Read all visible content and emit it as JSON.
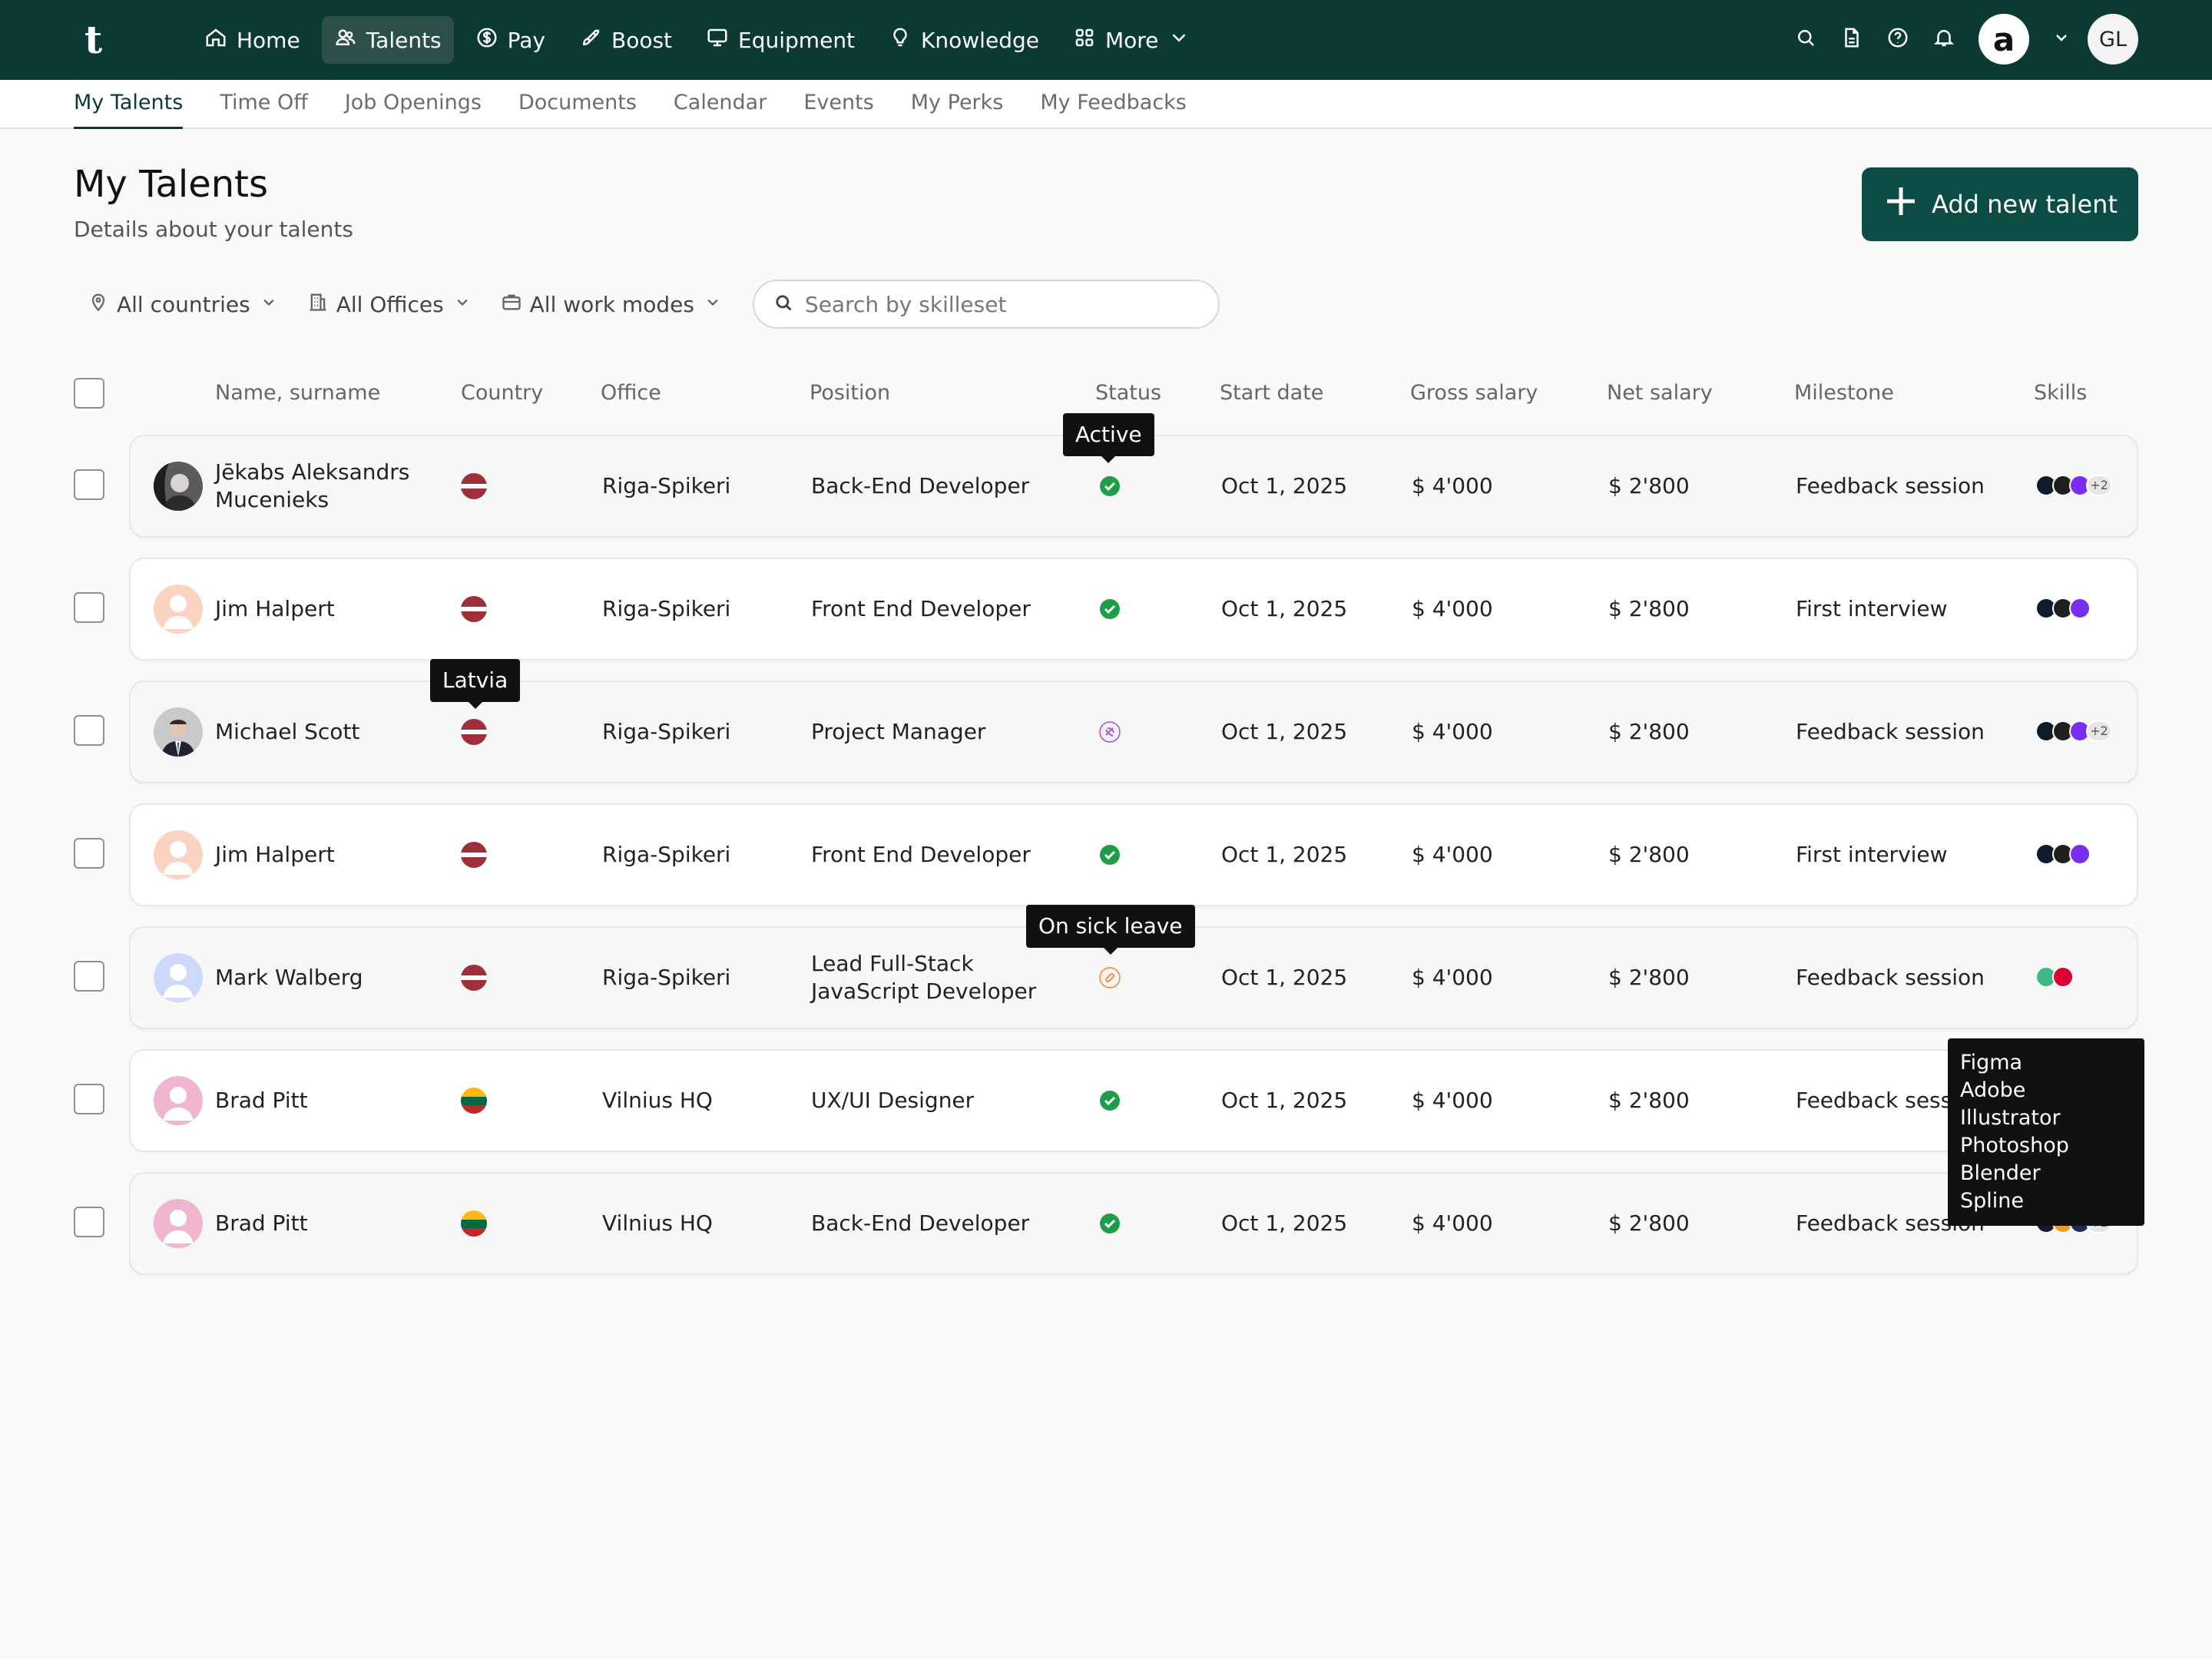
{
  "app": {
    "logo": "t"
  },
  "nav": [
    {
      "label": "Home",
      "icon": "home-icon"
    },
    {
      "label": "Talents",
      "icon": "users-icon",
      "active": true
    },
    {
      "label": "Pay",
      "icon": "dollar-icon"
    },
    {
      "label": "Boost",
      "icon": "rocket-icon"
    },
    {
      "label": "Equipment",
      "icon": "monitor-icon"
    },
    {
      "label": "Knowledge",
      "icon": "lightbulb-icon"
    },
    {
      "label": "More",
      "icon": "grid-icon"
    }
  ],
  "header_right": {
    "company_logo": "a",
    "user_initials": "GL"
  },
  "subnav": [
    "My Talents",
    "Time Off",
    "Job Openings",
    "Documents",
    "Calendar",
    "Events",
    "My Perks",
    "My Feedbacks"
  ],
  "page": {
    "title": "My Talents",
    "subtitle": "Details about your talents",
    "add_button": "Add new talent"
  },
  "filters": {
    "countries": "All countries",
    "offices": "All Offices",
    "work_modes": "All work modes",
    "search_placeholder": "Search by skilleset"
  },
  "columns": {
    "name": "Name, surname",
    "country": "Country",
    "office": "Office",
    "position": "Position",
    "status": "Status",
    "start_date": "Start date",
    "gross": "Gross salary",
    "net": "Net salary",
    "milestone": "Milestone",
    "skills": "Skills"
  },
  "rows": [
    {
      "name": "Jēkabs Aleksandrs Mucenieks",
      "country": "latvia",
      "office": "Riga-Spikeri",
      "position": "Back-End Developer",
      "status": "active",
      "start": "Oct 1, 2025",
      "gross": "$ 4'000",
      "net": "$ 2'800",
      "milestone": "Feedback session",
      "skills_more": "+2",
      "avatar": "photo-dark"
    },
    {
      "name": "Jim Halpert",
      "country": "latvia",
      "office": "Riga-Spikeri",
      "position": "Front End Developer",
      "status": "active",
      "start": "Oct 1, 2025",
      "gross": "$ 4'000",
      "net": "$ 2'800",
      "milestone": "First interview",
      "skills_more": "",
      "avatar": "placeholder-peach"
    },
    {
      "name": "Michael Scott",
      "country": "latvia",
      "office": "Riga-Spikeri",
      "position": "Project Manager",
      "status": "vacation",
      "start": "Oct 1, 2025",
      "gross": "$ 4'000",
      "net": "$ 2'800",
      "milestone": "Feedback session",
      "skills_more": "+2",
      "avatar": "photo-suit"
    },
    {
      "name": "Jim Halpert",
      "country": "latvia",
      "office": "Riga-Spikeri",
      "position": "Front End Developer",
      "status": "active",
      "start": "Oct 1, 2025",
      "gross": "$ 4'000",
      "net": "$ 2'800",
      "milestone": "First interview",
      "skills_more": "",
      "avatar": "placeholder-peach"
    },
    {
      "name": "Mark Walberg",
      "country": "latvia",
      "office": "Riga-Spikeri",
      "position": "Lead Full-Stack JavaScript Developer",
      "status": "sick",
      "start": "Oct 1, 2025",
      "gross": "$ 4'000",
      "net": "$ 2'800",
      "milestone": "Feedback session",
      "skills_more": "",
      "avatar": "placeholder-blue"
    },
    {
      "name": "Brad Pitt",
      "country": "lithuania",
      "office": "Vilnius HQ",
      "position": "UX/UI Designer",
      "status": "active",
      "start": "Oct 1, 2025",
      "gross": "$ 4'000",
      "net": "$ 2'800",
      "milestone": "Feedback session",
      "skills_more": "",
      "avatar": "placeholder-pink"
    },
    {
      "name": "Brad Pitt",
      "country": "lithuania",
      "office": "Vilnius HQ",
      "position": "Back-End Developer",
      "status": "active",
      "start": "Oct 1, 2025",
      "gross": "$ 4'000",
      "net": "$ 2'800",
      "milestone": "Feedback session",
      "skills_more": "+2",
      "avatar": "placeholder-pink"
    }
  ],
  "tooltips": {
    "active": "Active",
    "country": "Latvia",
    "sick": "On sick leave",
    "skills": [
      "Figma",
      "Adobe Illustrator",
      "Photoshop",
      "Blender",
      "Spline"
    ]
  },
  "colors": {
    "brand": "#0b3a33",
    "button": "#0b4d44",
    "active_status": "#1e9e4a"
  }
}
